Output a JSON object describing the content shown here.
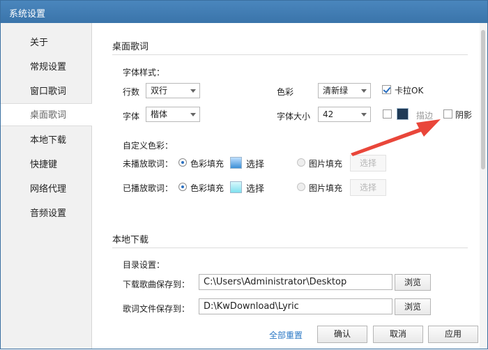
{
  "window": {
    "title": "系统设置"
  },
  "sidebar": {
    "items": [
      {
        "label": "关于"
      },
      {
        "label": "常规设置"
      },
      {
        "label": "窗口歌词"
      },
      {
        "label": "桌面歌词"
      },
      {
        "label": "本地下载"
      },
      {
        "label": "快捷键"
      },
      {
        "label": "网络代理"
      },
      {
        "label": "音频设置"
      }
    ],
    "active_index": 3
  },
  "desktop_lyrics": {
    "section_title": "桌面歌词",
    "font_style_label": "字体样式：",
    "rows_label": "行数",
    "rows_value": "双行",
    "color_label": "色彩",
    "color_value": "清新绿",
    "karaoke_label": "卡拉OK",
    "font_label": "字体",
    "font_value": "楷体",
    "font_size_label": "字体大小",
    "font_size_value": "42",
    "stroke_label": "描边",
    "shadow_label": "阴影",
    "custom_color_label": "自定义色彩：",
    "unplayed_label": "未播放歌词：",
    "played_label": "已播放歌词：",
    "color_fill_label": "色彩填充",
    "image_fill_label": "图片填充",
    "choose_label": "选择",
    "colors": {
      "stroke_swatch": "#1f3a56",
      "unplayed_fill": "#3c8fd6",
      "played_fill": "#7fe0ee",
      "arrow": "#e9463a"
    }
  },
  "local_download": {
    "section_title": "本地下载",
    "dir_settings_label": "目录设置：",
    "song_save_label": "下载歌曲保存到：",
    "song_save_path": "C:\\Users\\Administrator\\Desktop",
    "lyric_save_label": "歌词文件保存到：",
    "lyric_save_path": "D:\\KwDownload\\Lyric",
    "browse_label": "浏览"
  },
  "footer": {
    "reset_all": "全部重置",
    "ok": "确认",
    "cancel": "取消",
    "apply": "应用"
  }
}
